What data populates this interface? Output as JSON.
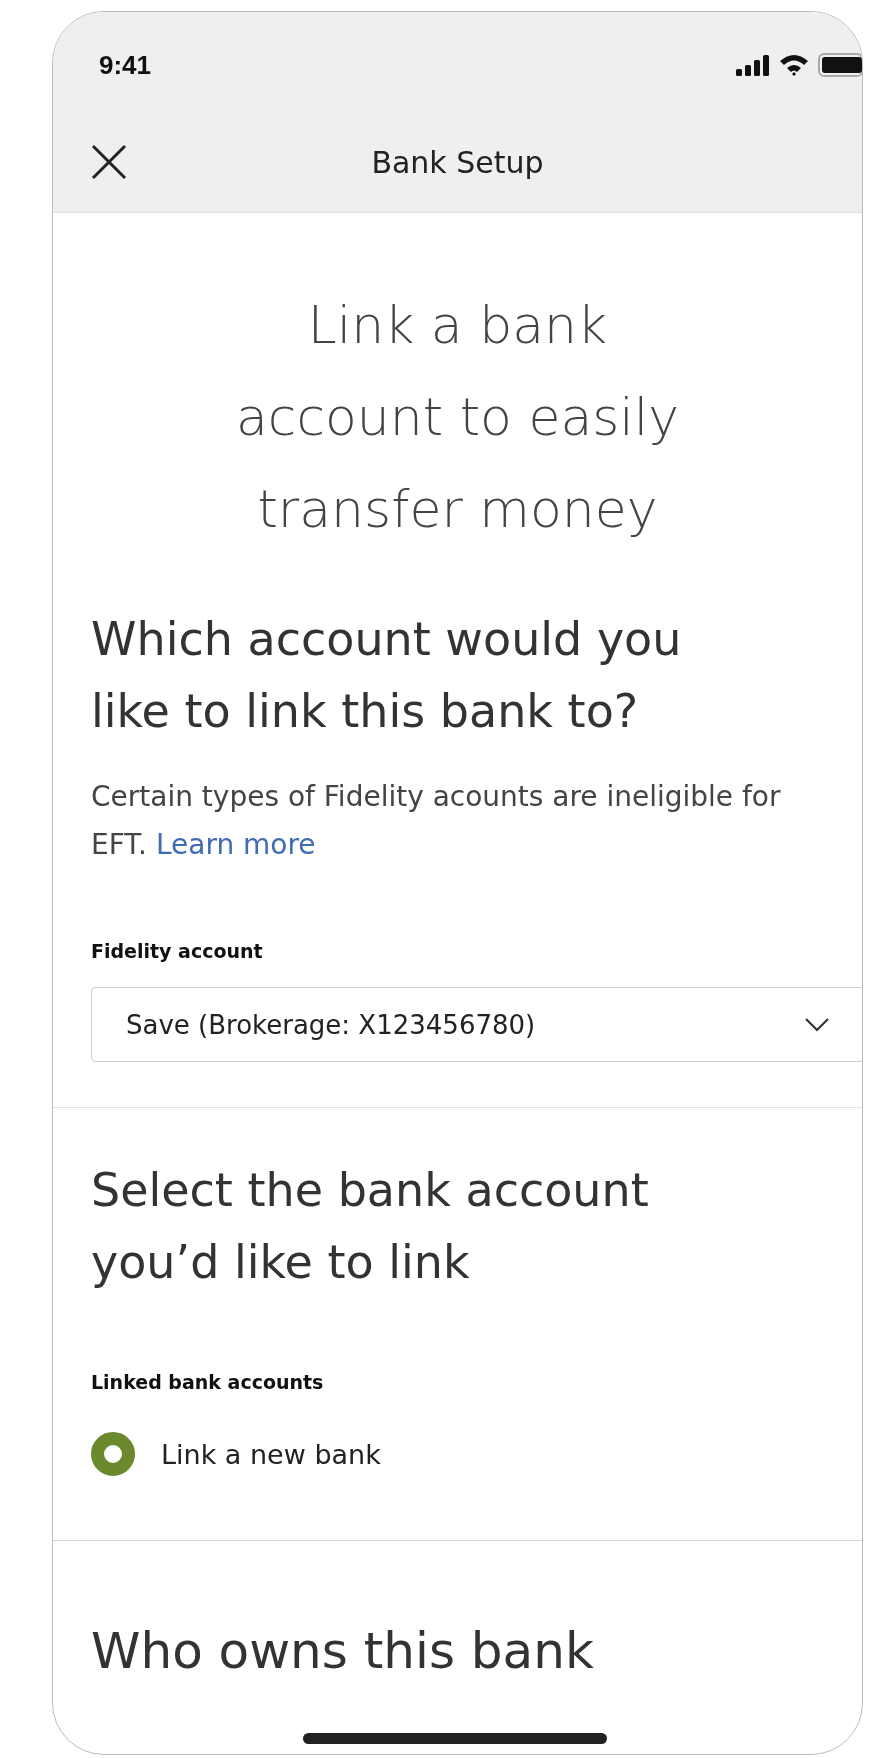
{
  "status_bar": {
    "time": "9:41"
  },
  "nav": {
    "title": "Bank Setup"
  },
  "headline": "Link a bank account to easily transfer money",
  "account_section": {
    "heading": "Which account would you like to link this bank to?",
    "description": "Certain types of Fidelity acounts are ineligible for EFT.",
    "link": "Learn more",
    "field_label": "Fidelity account",
    "dropdown": {
      "value": "Save (Brokerage: X123456780)"
    }
  },
  "bank_section": {
    "heading": "Select the bank account you’d like to link",
    "group_label": "Linked bank accounts",
    "options": [
      {
        "label": "Link a new bank",
        "selected": true
      }
    ]
  },
  "owner_section": {
    "heading": "Who owns this bank"
  }
}
